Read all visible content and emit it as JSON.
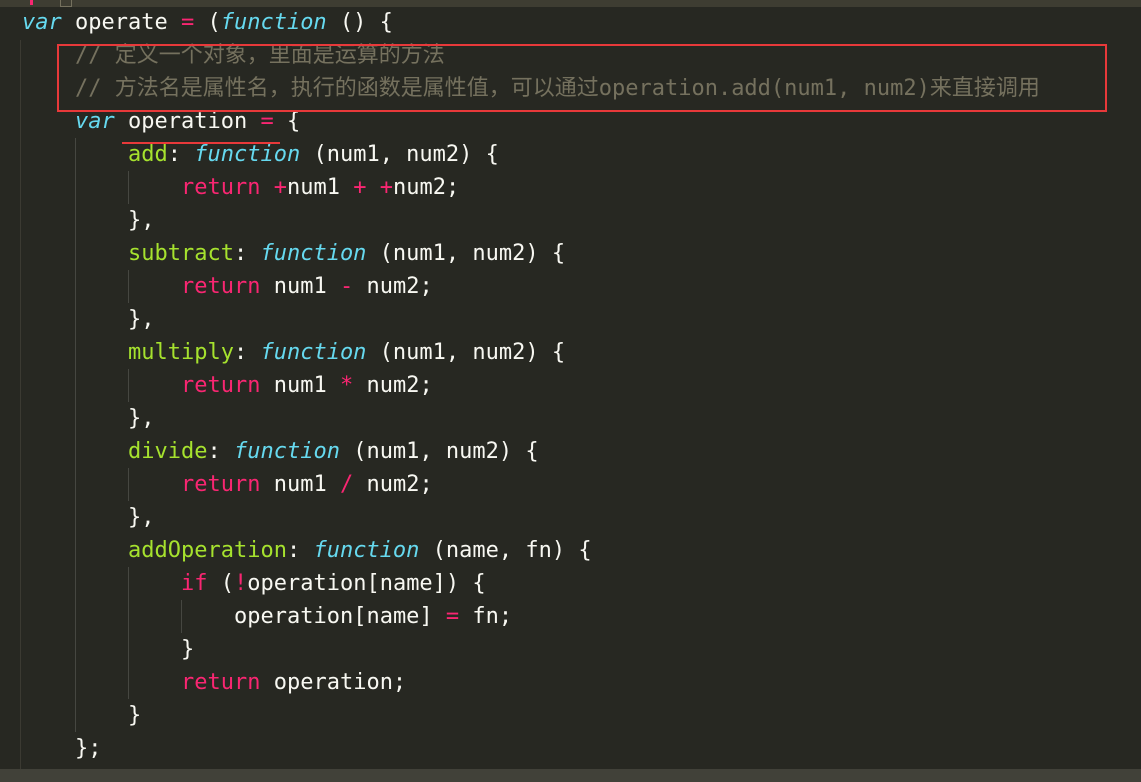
{
  "editor": {
    "theme_colors": {
      "background": "#272822",
      "keyword": "#66d9ef",
      "operator": "#f92672",
      "function_name": "#a6e22e",
      "text": "#f8f8f2",
      "comment": "#75715e",
      "highlight": "#e8393a"
    },
    "lines": [
      {
        "indent": 0,
        "tokens": [
          {
            "t": "k",
            "v": "var"
          },
          {
            "t": "p",
            "v": " operate "
          },
          {
            "t": "o",
            "v": "="
          },
          {
            "t": "p",
            "v": " ("
          },
          {
            "t": "k",
            "v": "function"
          },
          {
            "t": "p",
            "v": " () {"
          }
        ]
      },
      {
        "indent": 1,
        "tokens": [
          {
            "t": "c",
            "v": "// 定义一个对象，里面是运算的方法"
          }
        ]
      },
      {
        "indent": 1,
        "tokens": [
          {
            "t": "c",
            "v": "// 方法名是属性名，执行的函数是属性值，可以通过operation.add(num1, num2)来直接调用"
          }
        ]
      },
      {
        "indent": 1,
        "tokens": [
          {
            "t": "k",
            "v": "var"
          },
          {
            "t": "p",
            "v": " operation "
          },
          {
            "t": "o",
            "v": "="
          },
          {
            "t": "p",
            "v": " {"
          }
        ]
      },
      {
        "indent": 2,
        "tokens": [
          {
            "t": "f",
            "v": "add"
          },
          {
            "t": "p",
            "v": ": "
          },
          {
            "t": "k",
            "v": "function"
          },
          {
            "t": "p",
            "v": " (num1, num2) {"
          }
        ]
      },
      {
        "indent": 3,
        "tokens": [
          {
            "t": "o",
            "v": "return"
          },
          {
            "t": "p",
            "v": " "
          },
          {
            "t": "o",
            "v": "+"
          },
          {
            "t": "p",
            "v": "num1 "
          },
          {
            "t": "o",
            "v": "+"
          },
          {
            "t": "p",
            "v": " "
          },
          {
            "t": "o",
            "v": "+"
          },
          {
            "t": "p",
            "v": "num2;"
          }
        ]
      },
      {
        "indent": 2,
        "tokens": [
          {
            "t": "p",
            "v": "},"
          }
        ]
      },
      {
        "indent": 2,
        "tokens": [
          {
            "t": "f",
            "v": "subtract"
          },
          {
            "t": "p",
            "v": ": "
          },
          {
            "t": "k",
            "v": "function"
          },
          {
            "t": "p",
            "v": " (num1, num2) {"
          }
        ]
      },
      {
        "indent": 3,
        "tokens": [
          {
            "t": "o",
            "v": "return"
          },
          {
            "t": "p",
            "v": " num1 "
          },
          {
            "t": "o",
            "v": "-"
          },
          {
            "t": "p",
            "v": " num2;"
          }
        ]
      },
      {
        "indent": 2,
        "tokens": [
          {
            "t": "p",
            "v": "},"
          }
        ]
      },
      {
        "indent": 2,
        "tokens": [
          {
            "t": "f",
            "v": "multiply"
          },
          {
            "t": "p",
            "v": ": "
          },
          {
            "t": "k",
            "v": "function"
          },
          {
            "t": "p",
            "v": " (num1, num2) {"
          }
        ]
      },
      {
        "indent": 3,
        "tokens": [
          {
            "t": "o",
            "v": "return"
          },
          {
            "t": "p",
            "v": " num1 "
          },
          {
            "t": "o",
            "v": "*"
          },
          {
            "t": "p",
            "v": " num2;"
          }
        ]
      },
      {
        "indent": 2,
        "tokens": [
          {
            "t": "p",
            "v": "},"
          }
        ]
      },
      {
        "indent": 2,
        "tokens": [
          {
            "t": "f",
            "v": "divide"
          },
          {
            "t": "p",
            "v": ": "
          },
          {
            "t": "k",
            "v": "function"
          },
          {
            "t": "p",
            "v": " (num1, num2) {"
          }
        ]
      },
      {
        "indent": 3,
        "tokens": [
          {
            "t": "o",
            "v": "return"
          },
          {
            "t": "p",
            "v": " num1 "
          },
          {
            "t": "o",
            "v": "/"
          },
          {
            "t": "p",
            "v": " num2;"
          }
        ]
      },
      {
        "indent": 2,
        "tokens": [
          {
            "t": "p",
            "v": "},"
          }
        ]
      },
      {
        "indent": 2,
        "tokens": [
          {
            "t": "f",
            "v": "addOperation"
          },
          {
            "t": "p",
            "v": ": "
          },
          {
            "t": "k",
            "v": "function"
          },
          {
            "t": "p",
            "v": " (name, fn) {"
          }
        ]
      },
      {
        "indent": 3,
        "tokens": [
          {
            "t": "o",
            "v": "if"
          },
          {
            "t": "p",
            "v": " ("
          },
          {
            "t": "o",
            "v": "!"
          },
          {
            "t": "p",
            "v": "operation[name]) {"
          }
        ]
      },
      {
        "indent": 4,
        "tokens": [
          {
            "t": "p",
            "v": "operation[name] "
          },
          {
            "t": "o",
            "v": "="
          },
          {
            "t": "p",
            "v": " fn;"
          }
        ]
      },
      {
        "indent": 3,
        "tokens": [
          {
            "t": "p",
            "v": "}"
          }
        ]
      },
      {
        "indent": 3,
        "tokens": [
          {
            "t": "o",
            "v": "return"
          },
          {
            "t": "p",
            "v": " operation;"
          }
        ]
      },
      {
        "indent": 2,
        "tokens": [
          {
            "t": "p",
            "v": "}"
          }
        ]
      },
      {
        "indent": 1,
        "tokens": [
          {
            "t": "p",
            "v": "};"
          }
        ]
      }
    ]
  }
}
